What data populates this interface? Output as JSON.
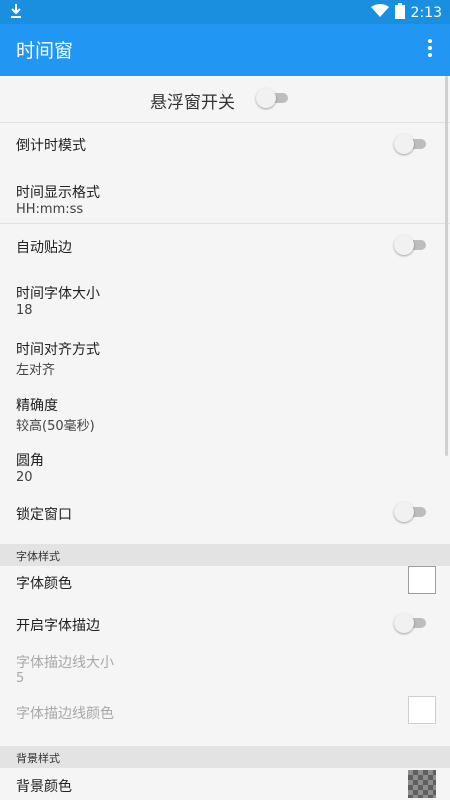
{
  "status_bar": {
    "time": "2:13",
    "download_icon": "download-icon",
    "wifi_icon": "wifi-icon",
    "battery_icon": "battery-icon"
  },
  "app_bar": {
    "title": "时间窗",
    "menu_icon": "more-vert-icon"
  },
  "master_switch": {
    "label": "悬浮窗开关",
    "on": false
  },
  "settings": {
    "countdown": {
      "label": "倒计时模式",
      "on": false
    },
    "time_format": {
      "label": "时间显示格式",
      "value": "HH:mm:ss"
    },
    "auto_snap": {
      "label": "自动贴边",
      "on": false
    },
    "font_size": {
      "label": "时间字体大小",
      "value": "18"
    },
    "align": {
      "label": "时间对齐方式",
      "value": "左对齐"
    },
    "precision": {
      "label": "精确度",
      "value": "较高(50毫秒)"
    },
    "corner": {
      "label": "圆角",
      "value": "20"
    },
    "lock": {
      "label": "锁定窗口",
      "on": false
    }
  },
  "font_style": {
    "header": "字体样式",
    "font_color": {
      "label": "字体颜色",
      "color": "#ffffff"
    },
    "stroke_toggle": {
      "label": "开启字体描边",
      "on": false
    },
    "stroke_size": {
      "label": "字体描边线大小",
      "value": "5"
    },
    "stroke_color": {
      "label": "字体描边线颜色",
      "color": "#ffffff"
    }
  },
  "background_style": {
    "header": "背景样式",
    "bg_color": {
      "label": "背景颜色",
      "color": "transparent"
    }
  },
  "colors": {
    "status_bar": "#1a8fe0",
    "app_bar": "#2196f3",
    "section_bg": "#e3e3e3"
  }
}
